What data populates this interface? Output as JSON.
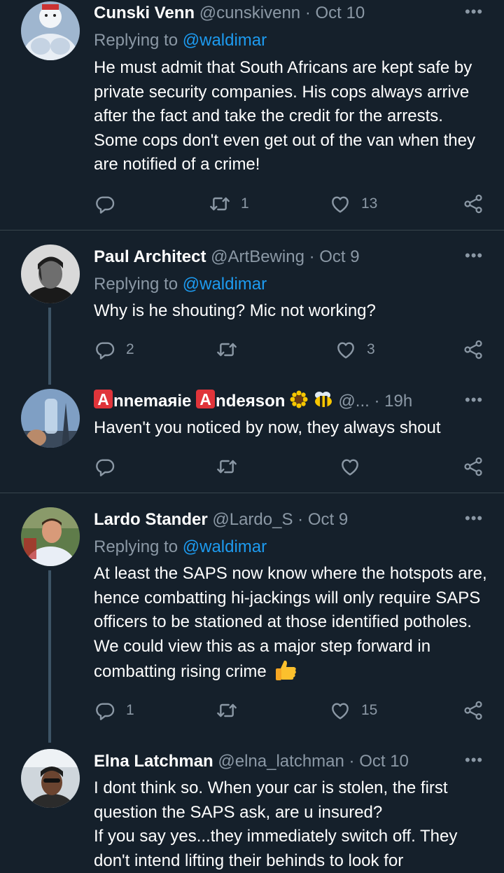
{
  "tweets": [
    {
      "name": "Cunski Venn",
      "handle": "@cunskivenn",
      "dot": "·",
      "time": "Oct 10",
      "reply_prefix": "Replying to",
      "reply_mention": "@waldimar",
      "text": "He must admit that South Africans are kept safe by private security companies.  His cops always arrive after the fact and take the credit for the arrests.  Some cops don't even get out of the van when they are notified of a crime!",
      "reply_count": "",
      "retweet_count": "1",
      "like_count": "13"
    },
    {
      "name": "Paul Architect",
      "handle": "@ArtBewing",
      "dot": "·",
      "time": "Oct 9",
      "reply_prefix": "Replying to",
      "reply_mention": "@waldimar",
      "text": "Why is he shouting? Mic not working?",
      "reply_count": "2",
      "retweet_count": "",
      "like_count": "3"
    },
    {
      "name_part1": "nnemaяie",
      "name_part2": "ndeяson",
      "badge_letter": "A",
      "handle": "@...",
      "dot": "·",
      "time": "19h",
      "text": "Haven't you noticed by now,  they always shout",
      "reply_count": "",
      "retweet_count": "",
      "like_count": ""
    },
    {
      "name": "Lardo Stander",
      "handle": "@Lardo_S",
      "dot": "·",
      "time": "Oct 9",
      "reply_prefix": "Replying to",
      "reply_mention": "@waldimar",
      "text": "At least the SAPS now know where the hotspots are, hence combatting hi-jackings will only require SAPS officers to be stationed at those identified potholes. We could view this as a major step forward in combatting rising crime",
      "reply_count": "1",
      "retweet_count": "",
      "like_count": "15"
    },
    {
      "name": "Elna Latchman",
      "handle": "@elna_latchman",
      "dot": "·",
      "time": "Oct 10",
      "text_lines": [
        "I dont think so. When your car is stolen, the first question the SAPS ask, are u insured?",
        "If you say yes...they immediately switch off. They don't intend lifting their behinds to look for"
      ]
    }
  ],
  "more_label": "•••",
  "icons": [
    "reply-icon",
    "retweet-icon",
    "like-icon",
    "share-icon",
    "more-icon",
    "thumbs-up-emoji",
    "sunflower-emoji",
    "bee-emoji"
  ],
  "colors": {
    "background": "#15202b",
    "text": "#ffffff",
    "muted": "#8b98a5",
    "link": "#1d9bf0",
    "divider": "#38444d"
  }
}
